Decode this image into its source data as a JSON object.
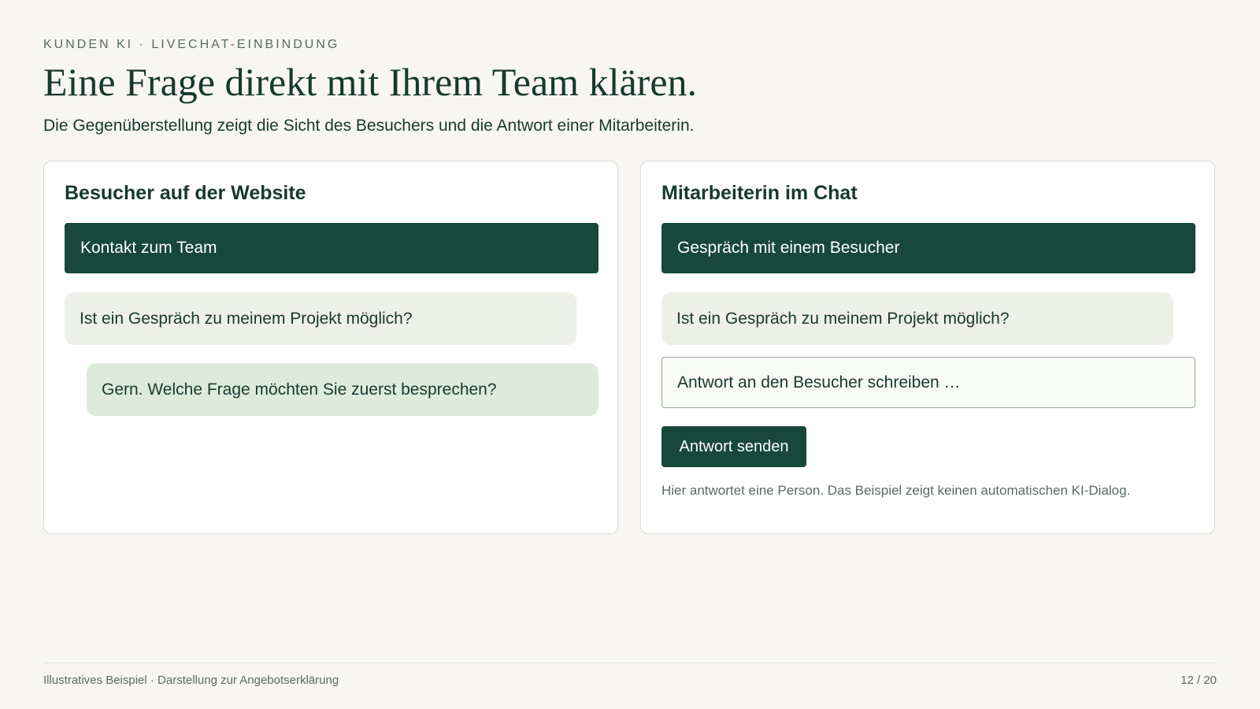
{
  "header": {
    "eyebrow": "KUNDEN KI · LIVECHAT-EINBINDUNG",
    "title": "Eine Frage direkt mit Ihrem Team klären.",
    "subtitle": "Die Gegenüberstellung zeigt die Sicht des Besuchers und die Antwort einer Mitarbeiterin."
  },
  "visitor_panel": {
    "title": "Besucher auf der Website",
    "bar_label": "Kontakt zum Team",
    "messages": [
      {
        "from": "visitor",
        "text": "Ist ein Gespräch zu meinem Projekt möglich?"
      },
      {
        "from": "staff",
        "text": "Gern. Welche Frage möchten Sie zuerst besprechen?"
      }
    ]
  },
  "staff_panel": {
    "title": "Mitarbeiterin im Chat",
    "bar_label": "Gespräch mit einem Besucher",
    "incoming_message": "Ist ein Gespräch zu meinem Projekt möglich?",
    "reply_placeholder": "Antwort an den Besucher schreiben …",
    "send_label": "Antwort senden",
    "note": "Hier antwortet eine Person. Das Beispiel zeigt keinen automatischen KI-Dialog."
  },
  "footer": {
    "caption": "Illustratives Beispiel · Darstellung zur Angebotserklärung",
    "page": "12 / 20"
  },
  "colors": {
    "background": "#f7f6f2",
    "primary": "#18473b",
    "text": "#17392f",
    "visitor_bubble": "#eef0ea",
    "staff_bubble": "#ddebda"
  }
}
